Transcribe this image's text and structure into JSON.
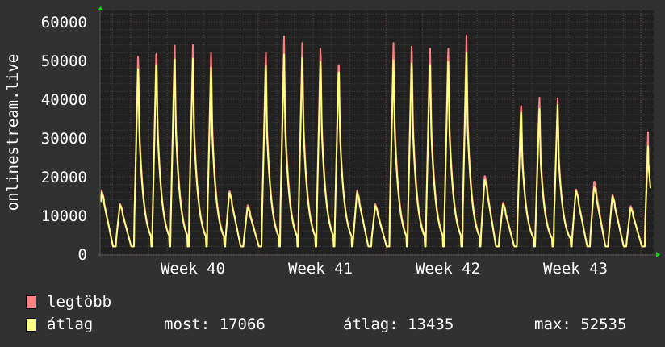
{
  "chart_data": {
    "type": "line",
    "ylabel": "onlinestream.live",
    "ylim": [
      0,
      60000
    ],
    "yticks": [
      "0",
      "10000",
      "20000",
      "30000",
      "40000",
      "50000",
      "60000"
    ],
    "xticks": [
      "Week 40",
      "Week 41",
      "Week 42",
      "Week 43"
    ],
    "grid": true,
    "trough": 2000,
    "series": [
      {
        "name": "legtöbb",
        "color": "#ff7f7f",
        "daily_peaks": [
          16500,
          13200,
          52800,
          54500,
          55300,
          54000,
          53000,
          16500,
          12800,
          53500,
          56300,
          55500,
          55000,
          51500,
          16500,
          13000,
          55500,
          55500,
          56000,
          54500,
          56500,
          20500,
          13500,
          40300,
          41500,
          40300,
          17000,
          19000,
          15500,
          12500,
          38000
        ]
      },
      {
        "name": "átlag",
        "color": "#ffff80",
        "daily_peaks": [
          16000,
          12800,
          49500,
          51500,
          51600,
          50500,
          49000,
          16000,
          12200,
          50000,
          51500,
          51500,
          51500,
          49500,
          16000,
          12500,
          51000,
          51000,
          51500,
          51000,
          52000,
          19500,
          13000,
          38500,
          38500,
          38500,
          16500,
          17500,
          15000,
          12000,
          33500
        ]
      }
    ],
    "last_value": 17066
  },
  "legend": {
    "max_label": "legtöbb",
    "avg_label": "átlag",
    "now": "most: 17066",
    "avg": "átlag: 13435",
    "max": "max: 52535"
  }
}
